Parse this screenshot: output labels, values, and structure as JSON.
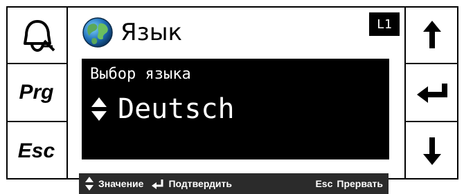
{
  "left_keys": [
    {
      "icon": "alarm-bell-icon"
    },
    {
      "label": "Prg"
    },
    {
      "label": "Esc"
    }
  ],
  "right_keys": [
    {
      "icon": "arrow-up-icon"
    },
    {
      "icon": "enter-icon"
    },
    {
      "icon": "arrow-down-icon"
    }
  ],
  "header": {
    "icon": "globe-icon",
    "title": "Язык",
    "level": "L1"
  },
  "panel": {
    "label": "Выбор языка",
    "value": "Deutsch"
  },
  "hint": {
    "value_label": "Значение",
    "confirm_label": "Подтвердить",
    "esc_label": "Esc",
    "cancel_label": "Прервать"
  },
  "colors": {
    "panel_bg": "#000000",
    "hint_bg": "#2b2b2b"
  }
}
